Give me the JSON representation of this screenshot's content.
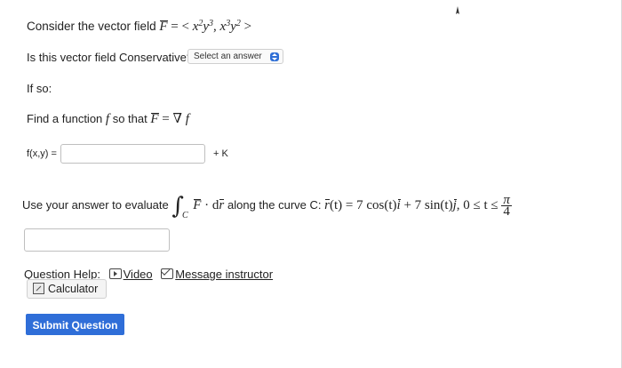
{
  "question": {
    "intro": "Consider the vector field",
    "field": "F",
    "field_eq": "= <",
    "comp1_base1": "x",
    "comp1_exp1": "2",
    "comp1_base2": "y",
    "comp1_exp2": "3",
    "comp_sep": ",",
    "comp2_base1": "x",
    "comp2_exp1": "3",
    "comp2_base2": "y",
    "comp2_exp2": "2",
    "field_close": ">",
    "conservative_prompt": "Is this vector field Conservative?",
    "select_value": "Select an answer",
    "if_so": "If so:",
    "find_prefix": "Find a function",
    "find_f": "f",
    "find_mid": "so that",
    "find_eq": "= ∇",
    "fxy_label": "f(x,y) =",
    "fxy_value": "",
    "plus_k": "+ K",
    "evaluate_prefix": "Use your answer to evaluate",
    "integral_sign": "∫",
    "integral_sub": "C",
    "dot_dr": "· d",
    "r": "r",
    "along": "along the curve C:",
    "curve_eq": "(t) = 7 cos(t)",
    "i_hat": "i",
    "plus7sin": "+ 7 sin(t)",
    "j_hat": "j",
    "range": ",   0 ≤ t ≤",
    "frac_num": "π",
    "frac_den": "4",
    "answer_value": ""
  },
  "help": {
    "label": "Question Help:",
    "video": "Video",
    "message": "Message instructor",
    "calculator": "Calculator"
  },
  "submit_label": "Submit Question"
}
